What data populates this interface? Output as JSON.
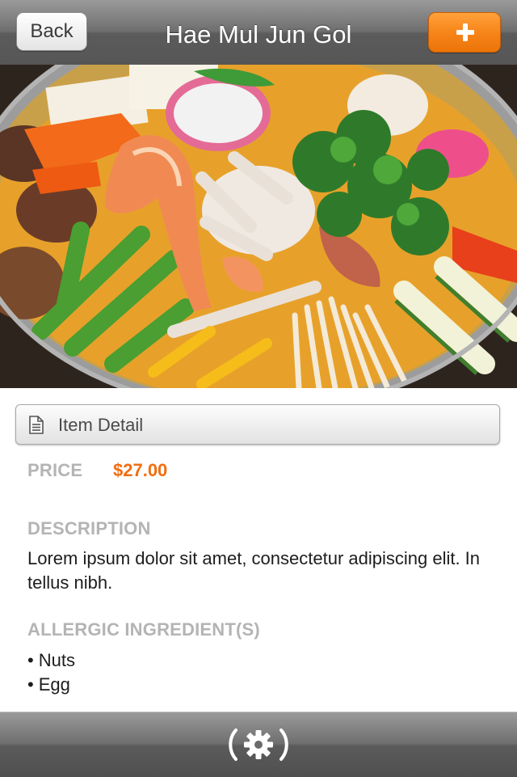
{
  "navbar": {
    "back_label": "Back",
    "title": "Hae Mul Jun Gol",
    "add_icon": "plus-icon",
    "accent_color": "#f7851a"
  },
  "hero": {
    "subject": "seafood-hot-pot-photo"
  },
  "detail": {
    "header_label": "Item Detail",
    "header_icon": "document-icon",
    "price_label": "PRICE",
    "price_value": "$27.00",
    "description_label": "DESCRIPTION",
    "description_text": "Lorem ipsum dolor sit amet, consectetur adipiscing elit. In tellus nibh.",
    "allergy_label": "ALLERGIC INGREDIENT(S)",
    "allergens": [
      "Nuts",
      "Egg"
    ],
    "bullet": "•"
  },
  "toolbar": {
    "settings_icon": "gear-icon"
  },
  "colors": {
    "price": "#f26d10",
    "label_gray": "#b4b4b4",
    "bar_gray": "#6f6f6f"
  }
}
